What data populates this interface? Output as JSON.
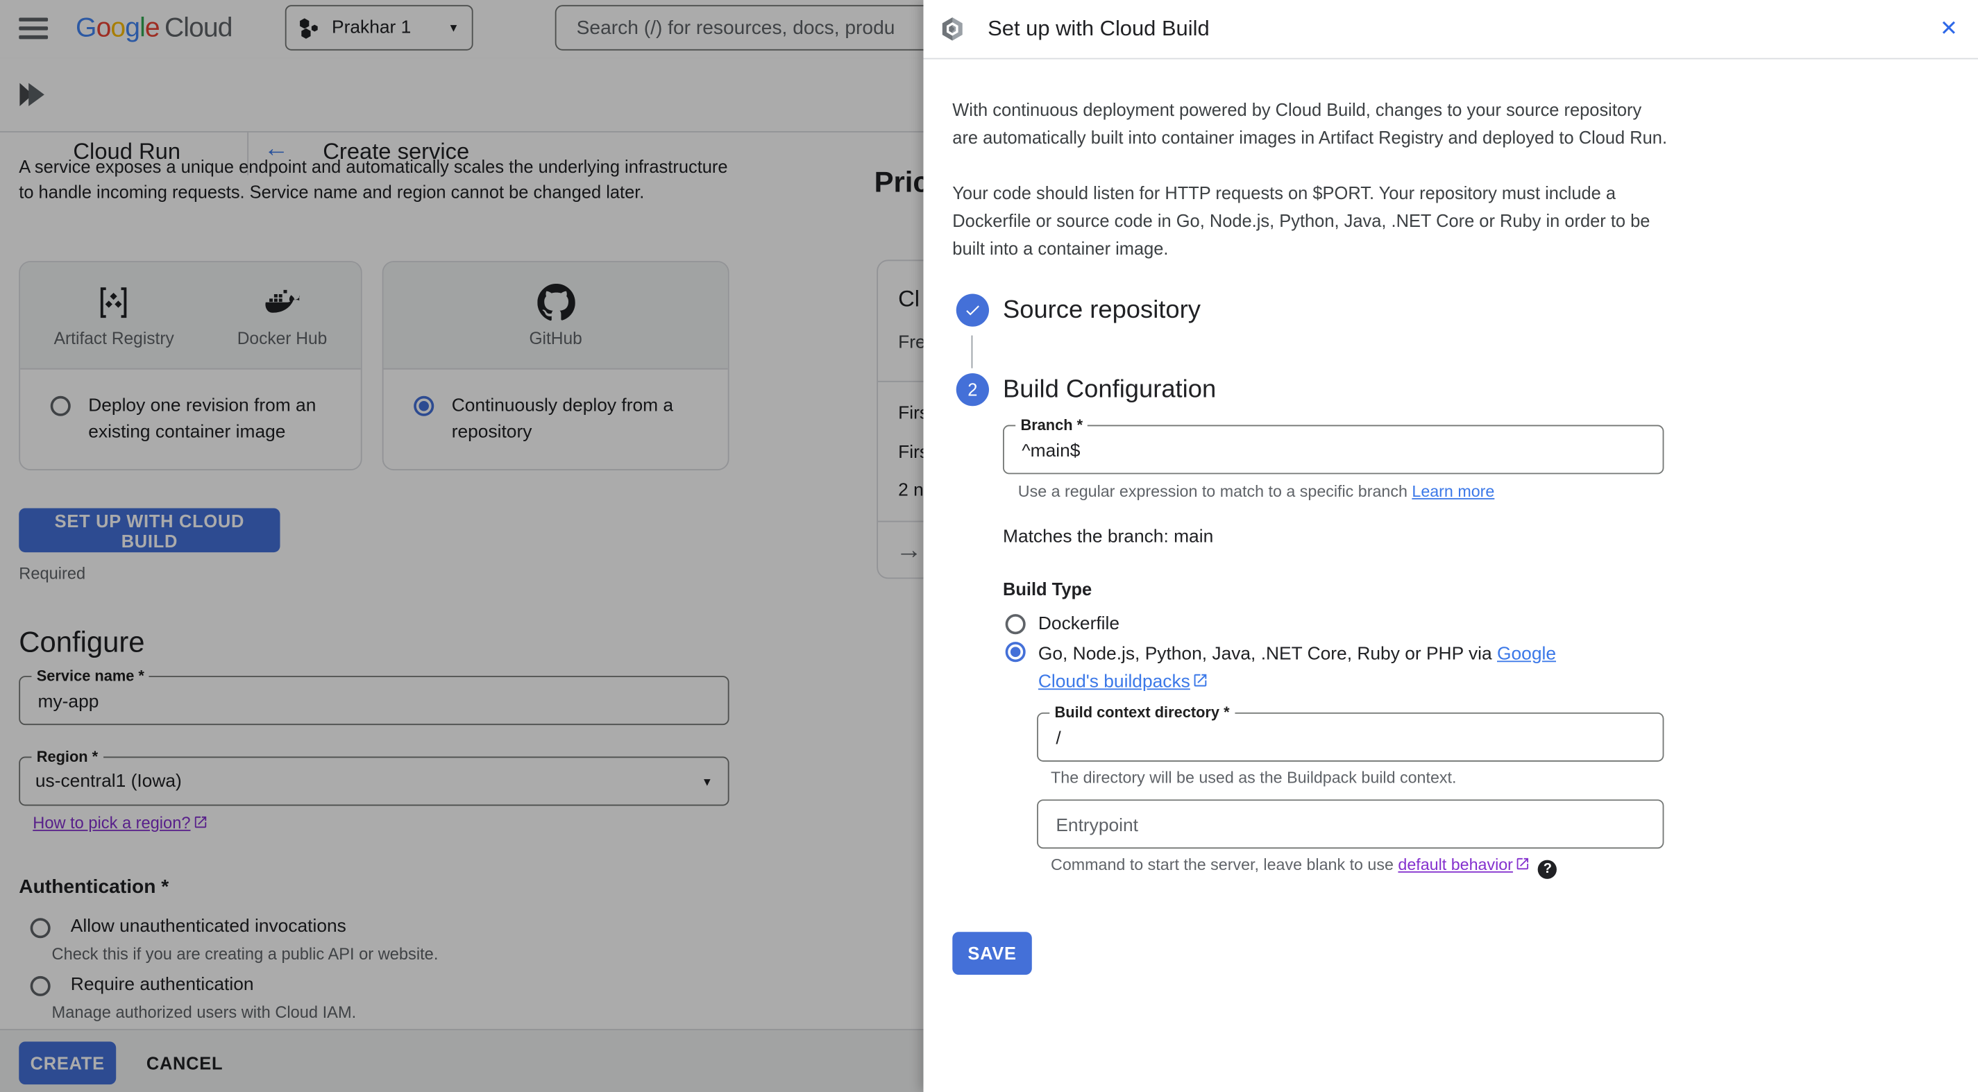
{
  "header": {
    "logo_letters": [
      {
        "ch": "G"
      },
      {
        "ch": "o"
      },
      {
        "ch": "o"
      },
      {
        "ch": "g"
      },
      {
        "ch": "l"
      },
      {
        "ch": "e"
      }
    ],
    "logo_cloud": "Cloud",
    "project_selector": {
      "label": "Prakhar 1"
    },
    "search": {
      "placeholder": "Search (/) for resources, docs, produ"
    }
  },
  "subheader": {
    "product": "Cloud Run",
    "page_title": "Create service"
  },
  "create_service": {
    "description": "A service exposes a unique endpoint and automatically scales the underlying infrastructure to handle incoming requests. Service name and region cannot be changed later.",
    "cards": [
      {
        "providers": [
          {
            "name": "Artifact Registry"
          },
          {
            "name": "Docker Hub"
          }
        ],
        "option": "Deploy one revision from an existing container image",
        "selected": false
      },
      {
        "providers": [
          {
            "name": "GitHub"
          }
        ],
        "option": "Continuously deploy from a repository",
        "selected": true
      }
    ],
    "setup_button": "SET UP WITH CLOUD BUILD",
    "required_note": "Required",
    "configure": {
      "heading": "Configure",
      "service_name": {
        "label": "Service name *",
        "value": "my-app"
      },
      "region": {
        "label": "Region *",
        "value": "us-central1 (Iowa)"
      },
      "region_link": "How to pick a region?"
    },
    "authentication": {
      "heading": "Authentication *",
      "options": [
        {
          "label": "Allow unauthenticated invocations",
          "description": "Check this if you are creating a public API or website.",
          "selected": false
        },
        {
          "label": "Require authentication",
          "description": "Manage authorized users with Cloud IAM.",
          "selected": false
        }
      ]
    },
    "footer": {
      "create": "CREATE",
      "cancel": "CANCEL"
    }
  },
  "pricing_fragment": {
    "heading_visible": "Pric",
    "card_title_visible": "Cl",
    "card_subtitle_visible": "Fre",
    "rows_visible": [
      "Firs",
      "Firs",
      "2 n"
    ]
  },
  "cloud_build_panel": {
    "title": "Set up with Cloud Build",
    "intro_paragraph_1": "With continuous deployment powered by Cloud Build, changes to your source repository are automatically built into container images in Artifact Registry and deployed to Cloud Run.",
    "intro_paragraph_2": "Your code should listen for HTTP requests on $PORT. Your repository must include a Dockerfile or source code in Go, Node.js, Python, Java, .NET Core or Ruby in order to be built into a container image.",
    "steps": [
      {
        "number": "1",
        "title": "Source repository",
        "state": "complete"
      },
      {
        "number": "2",
        "title": "Build Configuration",
        "state": "current"
      }
    ],
    "branch": {
      "label": "Branch *",
      "value": "^main$",
      "helper": "Use a regular expression to match to a specific branch ",
      "helper_link": "Learn more"
    },
    "match_note": "Matches the branch: main",
    "build_type": {
      "label": "Build Type",
      "option_dockerfile": {
        "label": "Dockerfile",
        "selected": false
      },
      "option_buildpacks": {
        "label_prefix": "Go, Node.js, Python, Java, .NET Core, Ruby or PHP via ",
        "link": "Google Cloud's buildpacks",
        "selected": true
      }
    },
    "build_context": {
      "label": "Build context directory *",
      "value": "/",
      "helper": "The directory will be used as the Buildpack build context."
    },
    "entrypoint": {
      "placeholder": "Entrypoint",
      "helper": "Command to start the server, leave blank to use ",
      "helper_link": "default behavior"
    },
    "save_button": "SAVE"
  },
  "icons": {
    "caret_down": "▼",
    "back_arrow": "←",
    "close": "✕",
    "arrow_right": "→",
    "check": "✓",
    "help": "?"
  },
  "colors": {
    "accent_blue": "#4470d8",
    "link_blue": "#3b78e8",
    "visited_purple": "#8430ce",
    "text_primary": "#202124",
    "text_secondary": "#5f6368",
    "border": "#dadce0",
    "field_border": "#747775",
    "card_header_bg": "#f1f3f4",
    "scrim": "rgba(0,0,0,0.33)"
  }
}
